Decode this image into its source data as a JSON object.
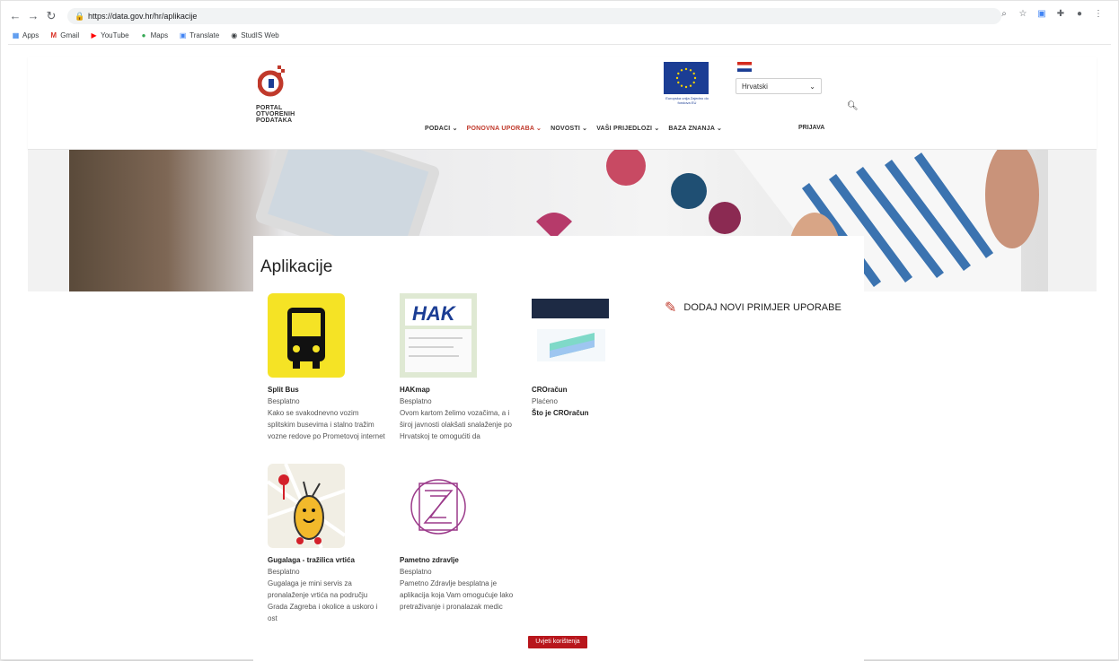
{
  "browser": {
    "url": "https://data.gov.hr/hr/aplikacije",
    "bookmarks": [
      "Apps",
      "Gmail",
      "YouTube",
      "Maps",
      "Translate",
      "StudIS Web"
    ]
  },
  "site": {
    "logo_lines": [
      "PORTAL",
      "OTVORENIH",
      "PODATAKA"
    ],
    "eu_caption": "Europska unija Zajedno do fondova EU",
    "language": "Hrvatski",
    "nav": [
      {
        "label": "PODACI ⌄"
      },
      {
        "label": "PONOVNA UPORABA ⌄"
      },
      {
        "label": "NOVOSTI ⌄"
      },
      {
        "label": "VAŠI PRIJEDLOZI ⌄"
      },
      {
        "label": "BAZA ZNANJA ⌄"
      }
    ],
    "login": "PRIJAVA"
  },
  "page": {
    "title": "Aplikacije",
    "add_new": "DODAJ NOVI PRIMJER UPORABE",
    "cookie_button": "Uvjeti korištenja"
  },
  "apps": [
    {
      "name": "Split Bus",
      "price": "Besplatno",
      "desc": "Kako se svakodnevno vozim splitskim busevima i stalno tražim vozne redove po Prometovoj internet",
      "link": ""
    },
    {
      "name": "HAKmap",
      "price": "Besplatno",
      "desc": "Ovom kartom želimo vozačima, a i široj javnosti olakšati snalaženje po Hrvatskoj te omogućiti da",
      "link": ""
    },
    {
      "name": "CROračun",
      "price": "Plaćeno",
      "desc": "",
      "link": "Što je CROračun"
    },
    {
      "name": "Gugalaga - tražilica vrtića",
      "price": "Besplatno",
      "desc": "Gugalaga je mini servis za pronalaženje vrtića na području Grada Zagreba i okolice a uskoro i ost",
      "link": ""
    },
    {
      "name": "Pametno zdravlje",
      "price": "Besplatno",
      "desc": "Pametno Zdravlje besplatna je aplikacija koja Vam omogućuje lako pretraživanje i pronalazak medic",
      "link": ""
    }
  ],
  "colors": {
    "accent": "#c0392b",
    "eu_blue": "#1b3d94",
    "cookie": "#b8161c"
  }
}
